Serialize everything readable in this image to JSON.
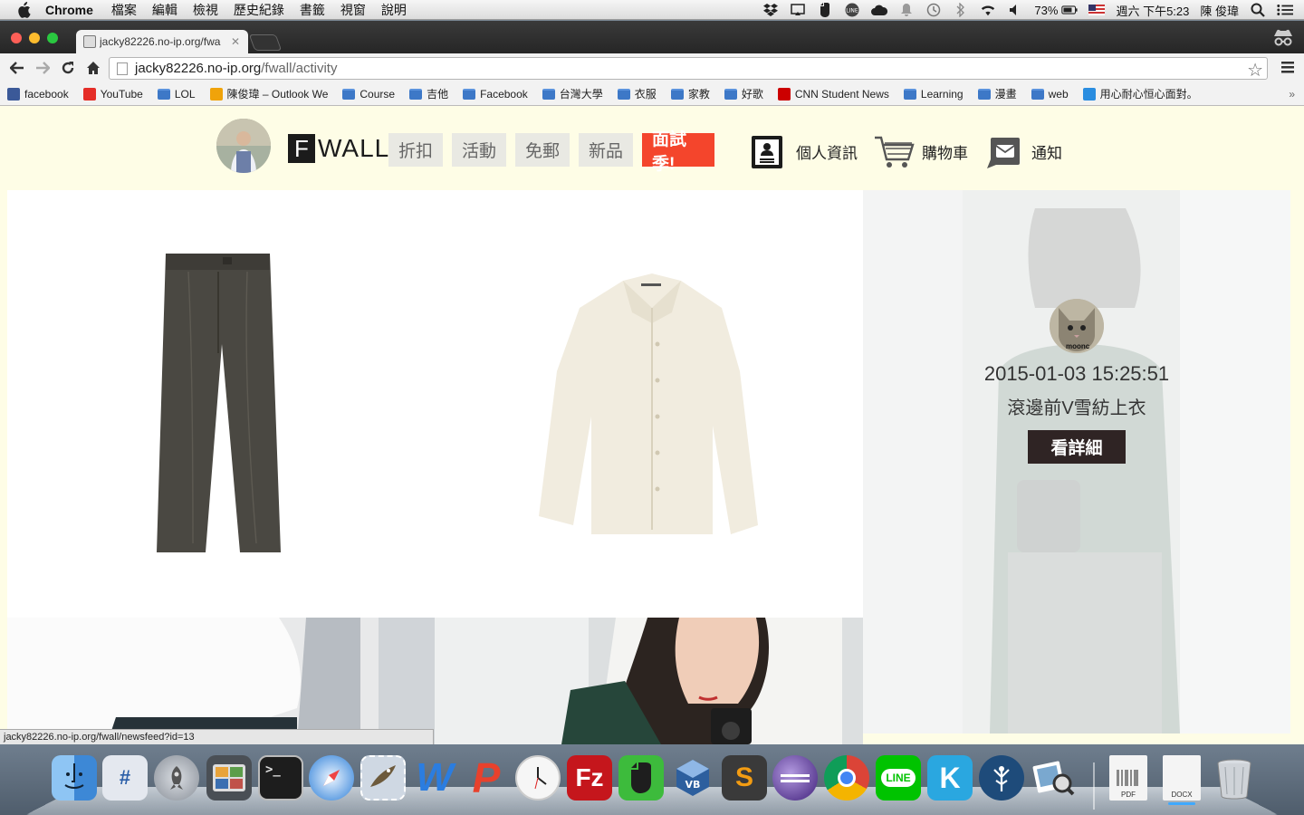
{
  "menubar": {
    "app_name": "Chrome",
    "menus": [
      "檔案",
      "編輯",
      "檢視",
      "歷史紀錄",
      "書籤",
      "視窗",
      "說明"
    ],
    "battery": "73%",
    "clock": "週六 下午5:23",
    "user": "陳 俊瑋"
  },
  "browser": {
    "tab_title": "jacky82226.no-ip.org/fwa",
    "url_host": "jacky82226.no-ip.org",
    "url_path": "/fwall/activity",
    "bookmarks": [
      {
        "label": "facebook",
        "icon": "facebook-icon",
        "color": "#3b5998"
      },
      {
        "label": "YouTube",
        "icon": "youtube-icon",
        "color": "#e52d27"
      },
      {
        "label": "LOL",
        "icon": "folder-icon",
        "color": "#3d78c7"
      },
      {
        "label": "陳俊瑋 – Outlook We",
        "icon": "outlook-icon",
        "color": "#f0a30a"
      },
      {
        "label": "Course",
        "icon": "folder-icon",
        "color": "#3d78c7"
      },
      {
        "label": "吉他",
        "icon": "folder-icon",
        "color": "#3d78c7"
      },
      {
        "label": "Facebook",
        "icon": "folder-icon",
        "color": "#3d78c7"
      },
      {
        "label": "台灣大學",
        "icon": "folder-icon",
        "color": "#3d78c7"
      },
      {
        "label": "衣服",
        "icon": "folder-icon",
        "color": "#3d78c7"
      },
      {
        "label": "家教",
        "icon": "folder-icon",
        "color": "#3d78c7"
      },
      {
        "label": "好歌",
        "icon": "folder-icon",
        "color": "#3d78c7"
      },
      {
        "label": "CNN Student News",
        "icon": "cnn-icon",
        "color": "#cc0000"
      },
      {
        "label": "Learning",
        "icon": "folder-icon",
        "color": "#3d78c7"
      },
      {
        "label": "漫畫",
        "icon": "folder-icon",
        "color": "#3d78c7"
      },
      {
        "label": "web",
        "icon": "folder-icon",
        "color": "#3d78c7"
      },
      {
        "label": "用心耐心恒心面對。",
        "icon": "app-icon",
        "color": "#2a8de0"
      }
    ],
    "bookmarks_more": "»",
    "status_url": "jacky82226.no-ip.org/fwall/newsfeed?id=13"
  },
  "site": {
    "logo_letter": "F",
    "logo_text": "WALL",
    "nav": [
      "折扣",
      "活動",
      "免郵",
      "新品"
    ],
    "nav_hot": "面試季!",
    "profile_label": "個人資訊",
    "cart_label": "購物車",
    "notify_label": "通知",
    "accent_color": "#f4452c"
  },
  "feature": {
    "avatar_caption": "moonc",
    "date": "2015-01-03 15:25:51",
    "title": "滾邊前V雪紡上衣",
    "detail_button": "看詳細"
  },
  "dock": {
    "pdf_label": "PDF",
    "docx_label": "DOCX"
  }
}
